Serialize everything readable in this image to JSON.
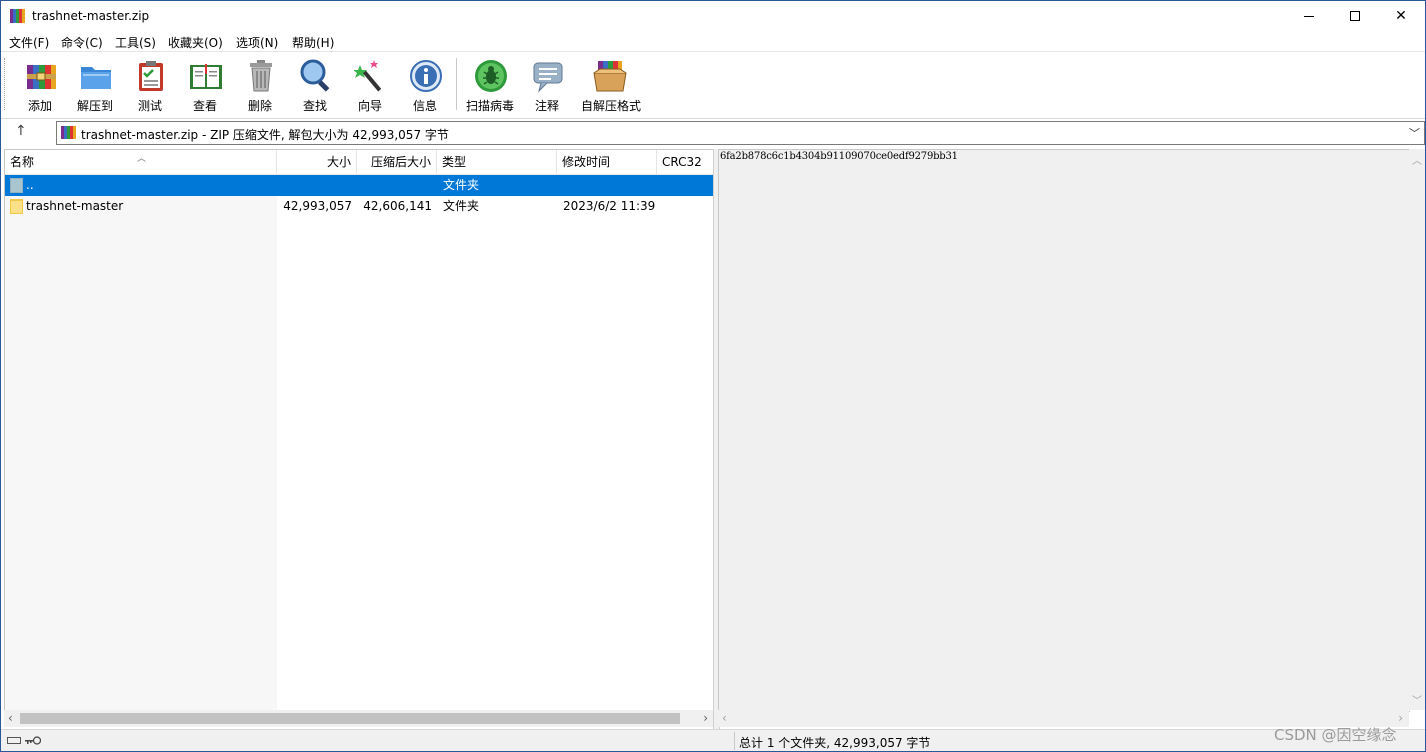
{
  "window": {
    "title": "trashnet-master.zip"
  },
  "menu": [
    {
      "label": "文件(F)"
    },
    {
      "label": "命令(C)"
    },
    {
      "label": "工具(S)"
    },
    {
      "label": "收藏夹(O)"
    },
    {
      "label": "选项(N)"
    },
    {
      "label": "帮助(H)"
    }
  ],
  "toolbar": [
    {
      "label": "添加",
      "icon": "add-archive-icon"
    },
    {
      "label": "解压到",
      "icon": "extract-folder-icon"
    },
    {
      "label": "测试",
      "icon": "test-clipboard-icon"
    },
    {
      "label": "查看",
      "icon": "view-book-icon"
    },
    {
      "label": "删除",
      "icon": "delete-trash-icon"
    },
    {
      "label": "查找",
      "icon": "find-magnifier-icon"
    },
    {
      "label": "向导",
      "icon": "wizard-wand-icon"
    },
    {
      "label": "信息",
      "icon": "info-icon"
    },
    {
      "label": "扫描病毒",
      "icon": "scan-virus-icon"
    },
    {
      "label": "注释",
      "icon": "comment-bubble-icon"
    },
    {
      "label": "自解压格式",
      "icon": "sfx-box-icon"
    }
  ],
  "address": {
    "text": "trashnet-master.zip - ZIP 压缩文件, 解包大小为 42,993,057 字节"
  },
  "columns": {
    "name": "名称",
    "size": "大小",
    "packed": "压缩后大小",
    "type": "类型",
    "modified": "修改时间",
    "crc": "CRC32"
  },
  "rows": [
    {
      "name": "..",
      "size": "",
      "packed": "",
      "type": "文件夹",
      "modified": "",
      "crc": ""
    },
    {
      "name": "trashnet-master",
      "size": "42,993,057",
      "packed": "42,606,141",
      "type": "文件夹",
      "modified": "2023/6/2 11:39",
      "crc": ""
    }
  ],
  "comment": {
    "text": "6fa2b878c6c1b4304b91109070ce0edf9279bb31"
  },
  "status": {
    "summary": "总计 1 个文件夹, 42,993,057 字节"
  },
  "watermark": "CSDN @因空缘念",
  "colors": {
    "selection": "#0078d7",
    "title_border": "#2b579a"
  }
}
